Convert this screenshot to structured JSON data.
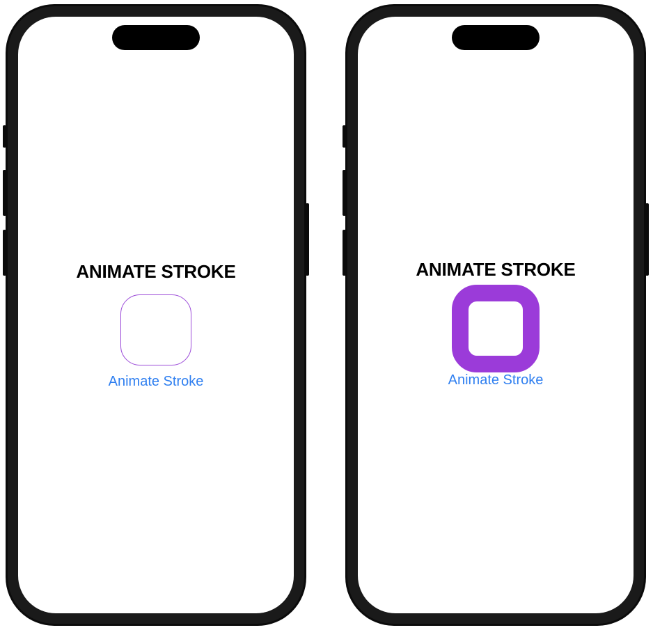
{
  "screens": [
    {
      "id": "before",
      "title": "ANIMATE STROKE",
      "button_label": "Animate Stroke",
      "stroke_state": "thin",
      "stroke_color": "#9b4ad8"
    },
    {
      "id": "after",
      "title": "ANIMATE STROKE",
      "button_label": "Animate Stroke",
      "stroke_state": "thick",
      "stroke_color": "#9b3bd9"
    }
  ],
  "colors": {
    "link": "#2f7ff0",
    "title": "#000000",
    "screen_background": "#ffffff",
    "device_frame": "#0b0b0b"
  }
}
